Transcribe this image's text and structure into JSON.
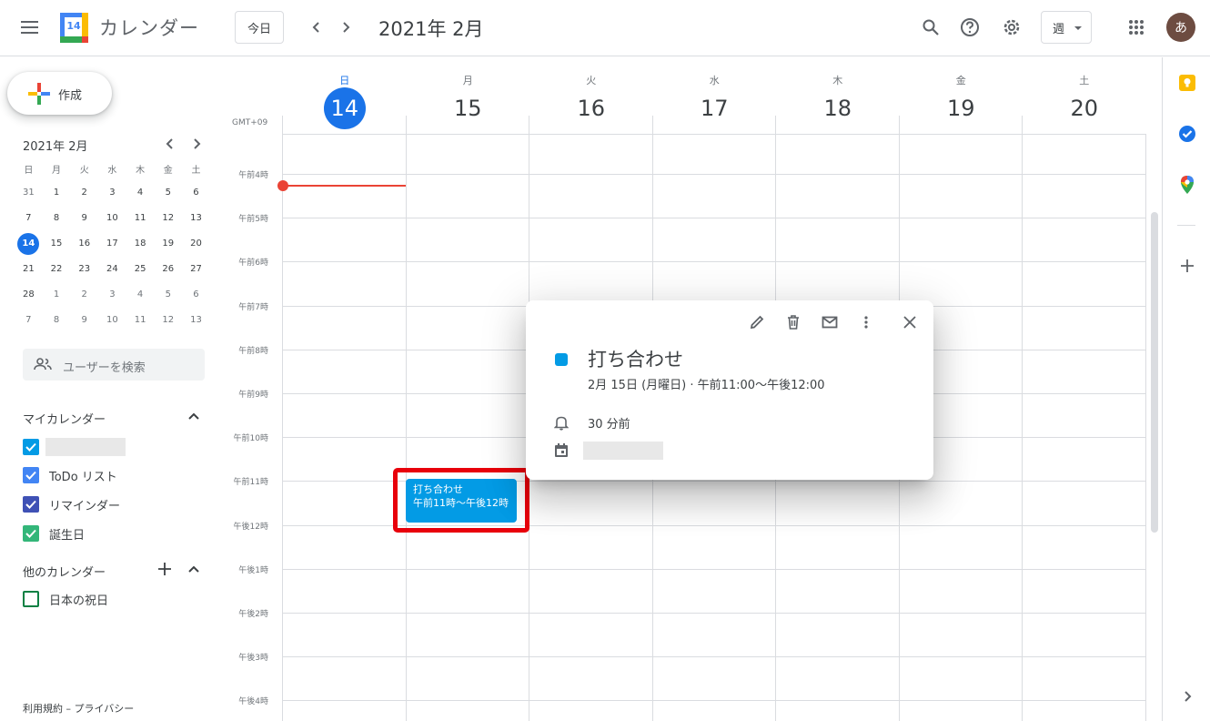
{
  "header": {
    "app_title": "カレンダー",
    "logo_day": "14",
    "today_label": "今日",
    "month_title": "2021年 2月",
    "view_label": "週",
    "avatar_letter": "あ"
  },
  "sidebar": {
    "create_label": "作成",
    "mini_title": "2021年 2月",
    "weekday_headers": [
      "日",
      "月",
      "火",
      "水",
      "木",
      "金",
      "土"
    ],
    "weeks": [
      [
        "31",
        "1",
        "2",
        "3",
        "4",
        "5",
        "6"
      ],
      [
        "7",
        "8",
        "9",
        "10",
        "11",
        "12",
        "13"
      ],
      [
        "14",
        "15",
        "16",
        "17",
        "18",
        "19",
        "20"
      ],
      [
        "21",
        "22",
        "23",
        "24",
        "25",
        "26",
        "27"
      ],
      [
        "28",
        "1",
        "2",
        "3",
        "4",
        "5",
        "6"
      ],
      [
        "7",
        "8",
        "9",
        "10",
        "11",
        "12",
        "13"
      ]
    ],
    "search_placeholder": "ユーザーを検索",
    "my_calendars_title": "マイカレンダー",
    "my_calendars": [
      {
        "label": "",
        "color": "#039be5"
      },
      {
        "label": "ToDo リスト",
        "color": "#4285f4"
      },
      {
        "label": "リマインダー",
        "color": "#3f51b5"
      },
      {
        "label": "誕生日",
        "color": "#33b679"
      }
    ],
    "other_calendars_title": "他のカレンダー",
    "other_calendars": [
      {
        "label": "日本の祝日",
        "color": "#0b8043"
      }
    ],
    "footer": "利用規約 – プライバシー"
  },
  "week": {
    "timezone": "GMT+09",
    "days": [
      {
        "dow": "日",
        "num": "14"
      },
      {
        "dow": "月",
        "num": "15"
      },
      {
        "dow": "火",
        "num": "16"
      },
      {
        "dow": "水",
        "num": "17"
      },
      {
        "dow": "木",
        "num": "18"
      },
      {
        "dow": "金",
        "num": "19"
      },
      {
        "dow": "土",
        "num": "20"
      }
    ],
    "hours": [
      "午前4時",
      "午前5時",
      "午前6時",
      "午前7時",
      "午前8時",
      "午前9時",
      "午前10時",
      "午前11時",
      "午後12時",
      "午後1時",
      "午後2時",
      "午後3時",
      "午後4時"
    ]
  },
  "event": {
    "title": "打ち合わせ",
    "time": "午前11時～午後12時",
    "color": "#039be5"
  },
  "popup": {
    "title": "打ち合わせ",
    "date_line": "2月 15日 (月曜日)  ·  午前11:00～午後12:00",
    "reminder": "30 分前"
  },
  "colors": {
    "accent": "#1a73e8",
    "now_line": "#ea4335",
    "highlight": "#e8000b"
  }
}
